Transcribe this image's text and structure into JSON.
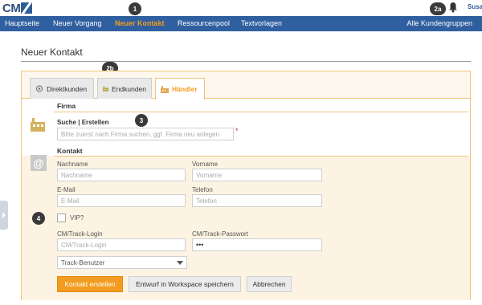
{
  "brand": {
    "logo_text": "CM"
  },
  "user": {
    "name": "Susa"
  },
  "nav": {
    "items": [
      {
        "label": "Hauptseite",
        "active": false
      },
      {
        "label": "Neuer Vorgang",
        "active": false
      },
      {
        "label": "Neuer Kontakt",
        "active": true
      },
      {
        "label": "Ressourcenpool",
        "active": false
      },
      {
        "label": "Textvorlagen",
        "active": false
      }
    ],
    "right_label": "Alle Kundengruppen"
  },
  "markers": {
    "m1": "1",
    "m2a": "2a",
    "m2b": "2b",
    "m3": "3",
    "m4": "4"
  },
  "page": {
    "title": "Neuer Kontakt"
  },
  "tabs": [
    {
      "label": "Direktkunden",
      "active": false
    },
    {
      "label": "Endkunden",
      "active": false
    },
    {
      "label": "Händler",
      "active": true
    }
  ],
  "firma": {
    "heading": "Firma",
    "search_label": "Suche | Erstellen",
    "search_placeholder": "Bitte zuerst nach Firma suchen, ggf. Firma neu anlegen",
    "required_mark": "*"
  },
  "kontakt": {
    "heading": "Kontakt",
    "nachname_label": "Nachname",
    "nachname_placeholder": "Nachname",
    "vorname_label": "Vorname",
    "vorname_placeholder": "Vorname",
    "email_label": "E-Mail",
    "email_placeholder": "E-Mail",
    "telefon_label": "Telefon",
    "telefon_placeholder": "Telefon",
    "vip_label": "VIP?",
    "vip_checked": false,
    "login_label": "CM/Track-Login",
    "login_placeholder": "CM/Track-Login",
    "password_label": "CM/Track-Passwort",
    "password_value": "•••",
    "role_select_value": "Track-Benutzer"
  },
  "actions": {
    "create_label": "Kontakt erstellen",
    "draft_label": "Entwurf in Workspace speichern",
    "cancel_label": "Abbrechen"
  },
  "colors": {
    "nav_bg": "#2f5f9f",
    "accent": "#f39c1f",
    "panel_border": "#f3c37a",
    "panel_fill": "#fdf3e3"
  }
}
